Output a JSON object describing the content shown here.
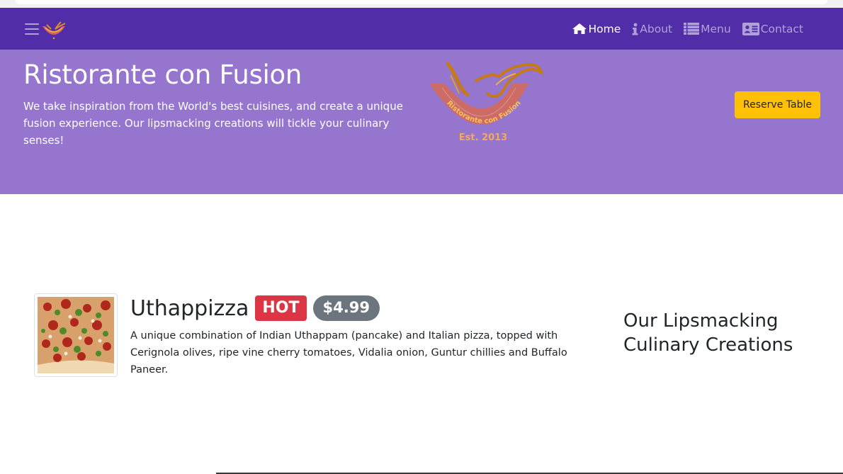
{
  "navbar": {
    "links": [
      {
        "label": "Home",
        "icon": "home-icon",
        "active": true
      },
      {
        "label": "About",
        "icon": "info-icon",
        "active": false
      },
      {
        "label": "Menu",
        "icon": "list-icon",
        "active": false
      },
      {
        "label": "Contact",
        "icon": "address-card-icon",
        "active": false
      }
    ]
  },
  "hero": {
    "title": "Ristorante con Fusion",
    "text": "We take inspiration from the World's best cuisines, and create a unique fusion experience. Our lipsmacking creations will tickle your culinary senses!",
    "logo_text": "Ristorante con Fusion",
    "logo_est": "Est. 2013",
    "reserve_label": "Reserve Table"
  },
  "featured": {
    "name": "Uthappizza",
    "badge": "HOT",
    "price": "$4.99",
    "description": "A unique combination of Indian Uthappam (pancake) and Italian pizza, topped with Cerignola olives, ripe vine cherry tomatoes, Vidalia onion, Guntur chillies and Buffalo Paneer."
  },
  "side": {
    "heading": "Our Lipsmacking Culinary Creations"
  },
  "colors": {
    "navbar": "#512da8",
    "jumbotron": "#9575cd",
    "reserve_button": "#ffc107",
    "hot_badge": "#dc3545",
    "price_badge": "#6c757d"
  }
}
